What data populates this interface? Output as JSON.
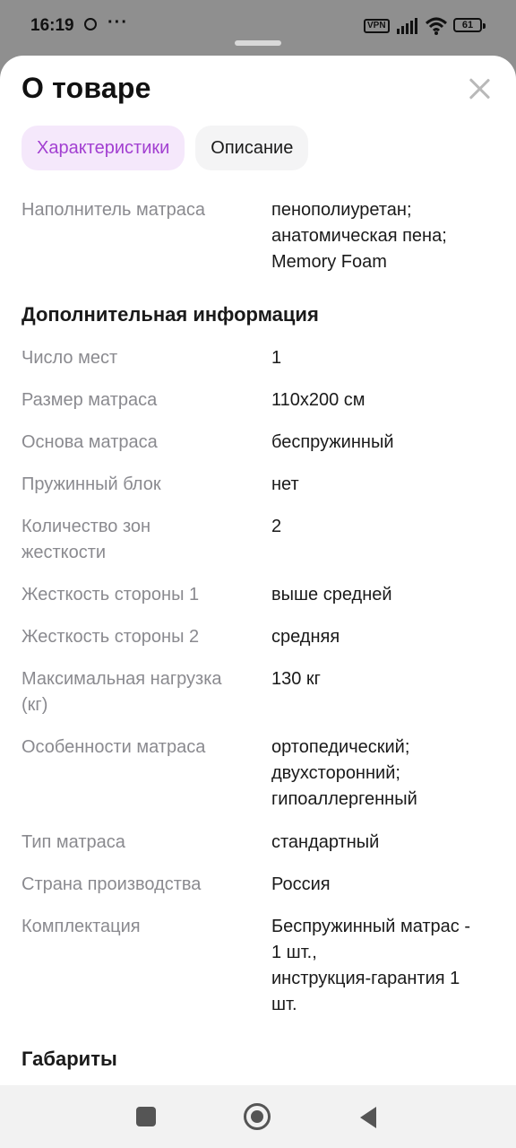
{
  "status_bar": {
    "time": "16:19",
    "dots": "···",
    "vpn": "VPN",
    "battery": "61"
  },
  "sheet": {
    "title": "О товаре"
  },
  "tabs": [
    {
      "label": "Характеристики",
      "active": true
    },
    {
      "label": "Описание",
      "active": false
    }
  ],
  "filler_row": {
    "key": "Наполнитель матраса",
    "value": [
      "пенополиуретан;",
      "анатомическая пена;",
      "Memory Foam"
    ]
  },
  "sections": {
    "additional": "Дополнительная информация",
    "dimensions": "Габариты"
  },
  "rows": [
    {
      "key": [
        "Число мест"
      ],
      "value": [
        "1"
      ]
    },
    {
      "key": [
        "Размер матраса"
      ],
      "value": [
        "110x200 см"
      ]
    },
    {
      "key": [
        "Основа матраса"
      ],
      "value": [
        "беспружинный"
      ]
    },
    {
      "key": [
        "Пружинный блок"
      ],
      "value": [
        "нет"
      ]
    },
    {
      "key": [
        "Количество зон",
        "жесткости"
      ],
      "value": [
        "2"
      ]
    },
    {
      "key": [
        "Жесткость стороны 1"
      ],
      "value": [
        "выше средней"
      ]
    },
    {
      "key": [
        "Жесткость стороны 2"
      ],
      "value": [
        "средняя"
      ]
    },
    {
      "key": [
        "Максимальная нагрузка",
        "(кг)"
      ],
      "value": [
        "130 кг"
      ]
    },
    {
      "key": [
        "Особенности матраса"
      ],
      "value": [
        "ортопедический;",
        "двухсторонний;",
        "гипоаллергенный"
      ]
    },
    {
      "key": [
        "Тип матраса"
      ],
      "value": [
        "стандартный"
      ]
    },
    {
      "key": [
        "Страна производства"
      ],
      "value": [
        "Россия"
      ]
    },
    {
      "key": [
        "Комплектация"
      ],
      "value": [
        "Беспружинный матрас -",
        "1 шт.,",
        "инструкция-гарантия 1",
        "шт."
      ]
    }
  ]
}
